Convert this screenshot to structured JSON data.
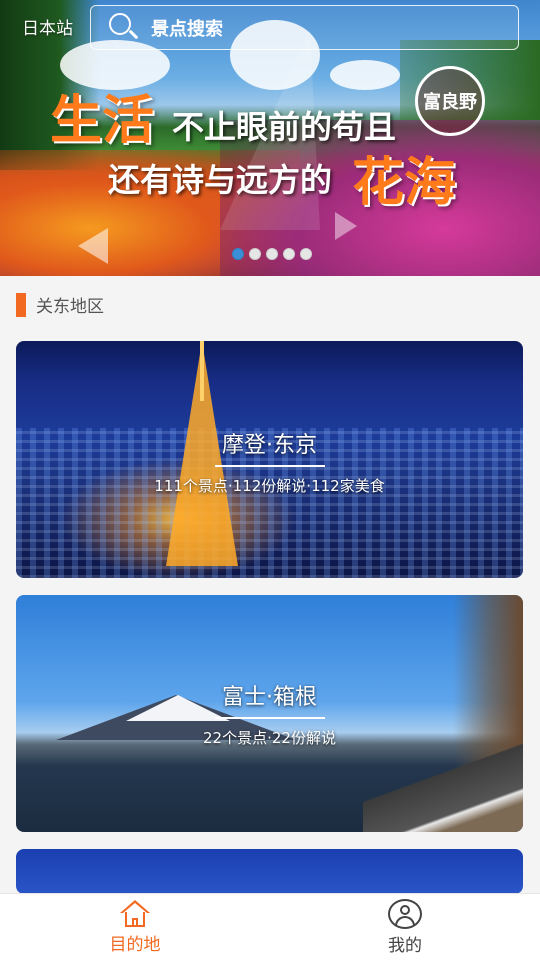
{
  "header": {
    "site_label": "日本站",
    "search_placeholder": "景点搜索"
  },
  "banner": {
    "slogan_line1_big": "生活",
    "slogan_line1_rest": "不止眼前的苟且",
    "slogan_line2_rest": "还有诗与远方的",
    "slogan_line2_big": "花海",
    "badge": "富良野",
    "slides_total": 5,
    "active_slide": 1
  },
  "section": {
    "title": "关东地区"
  },
  "cards": [
    {
      "title": "摩登·东京",
      "subtitle": "111个景点·112份解说·112家美食"
    },
    {
      "title": "富士·箱根",
      "subtitle": "22个景点·22份解说"
    }
  ],
  "bottom_nav": {
    "items": [
      {
        "label": "目的地",
        "icon": "home-icon",
        "active": true
      },
      {
        "label": "我的",
        "icon": "user-icon",
        "active": false
      }
    ]
  },
  "colors": {
    "accent": "#f26a21",
    "dot_active": "#3a8fd8"
  }
}
